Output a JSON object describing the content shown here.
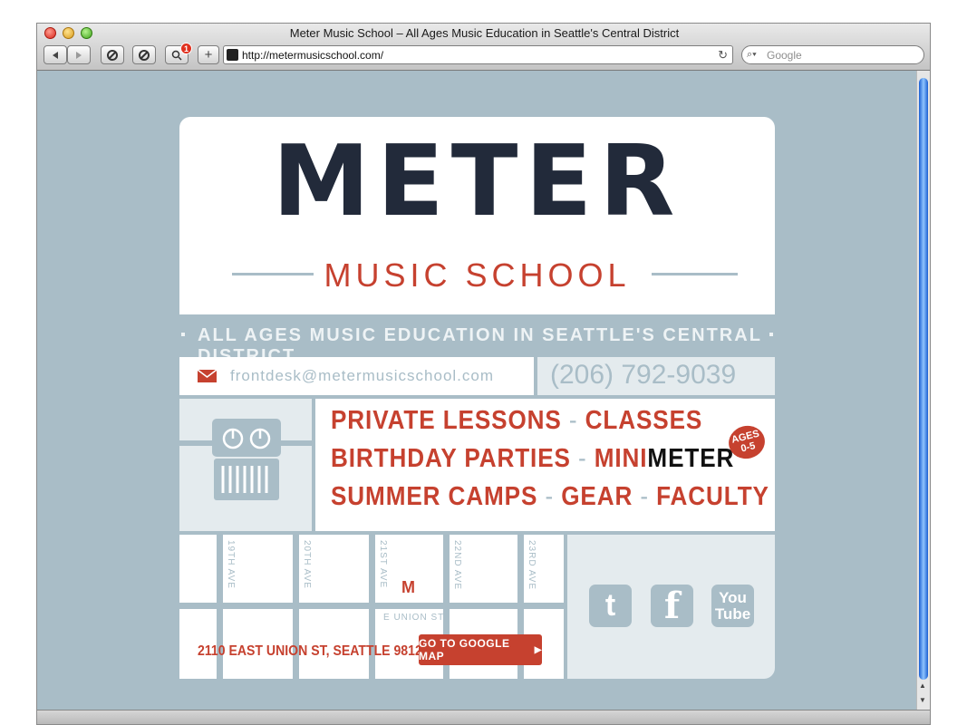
{
  "browser": {
    "window_title": "Meter Music School – All Ages Music Education in Seattle's Central District",
    "url": "http://metermusicschool.com/",
    "search_placeholder": "Google",
    "notification_count": "1",
    "add_label": "+"
  },
  "site": {
    "logo_word": "METER",
    "logo_sub": "MUSIC SCHOOL",
    "tagline": "ALL AGES MUSIC EDUCATION IN SEATTLE'S CENTRAL DISTRICT",
    "email": "frontdesk@metermusicschool.com",
    "phone": "(206) 792-9039",
    "nav": {
      "private_lessons": "PRIVATE LESSONS",
      "classes": "CLASSES",
      "birthday_parties": "BIRTHDAY PARTIES",
      "mini": "MINI",
      "meter": "METER",
      "summer_camps": "SUMMER CAMPS",
      "gear": "GEAR",
      "faculty": "FACULTY",
      "separator": "-"
    },
    "ages_badge_line1": "AGES",
    "ages_badge_line2": "0-5",
    "map": {
      "streets": [
        "19TH AVE",
        "20TH AVE",
        "21ST AVE",
        "22ND AVE",
        "23RD AVE"
      ],
      "cross_street": "E UNION ST",
      "marker": "M",
      "address": "2110 EAST UNION ST, SEATTLE 98122",
      "button": "GO TO GOOGLE MAP"
    },
    "social": {
      "twitter": "t",
      "facebook": "f",
      "youtube_line1": "You",
      "youtube_line2": "Tube"
    }
  },
  "colors": {
    "accent": "#c6412f",
    "background": "#a9bdc7",
    "dark": "#222a3a"
  }
}
